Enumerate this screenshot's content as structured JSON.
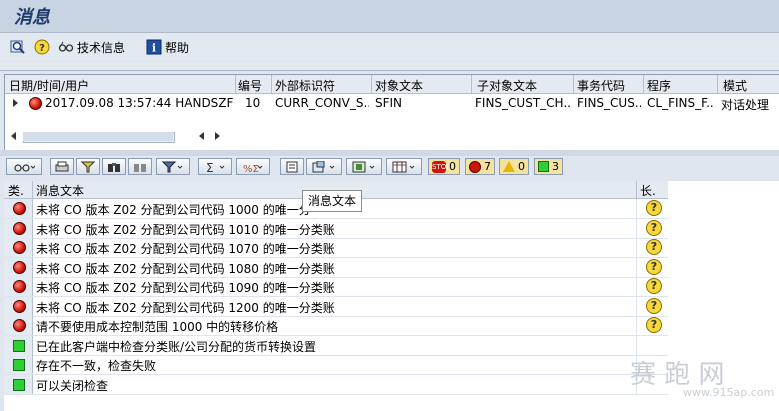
{
  "window": {
    "title": "消息"
  },
  "app_toolbar": {
    "items": [
      {
        "icon": "magnifier-icon",
        "label": ""
      },
      {
        "icon": "help-question-icon",
        "label": ""
      },
      {
        "icon": "glasses-icon",
        "label": "技术信息"
      },
      {
        "icon": "info-i-icon",
        "label": "帮助"
      }
    ]
  },
  "upper_table": {
    "headers": [
      "日期/时间/用户",
      "编号",
      "外部标识符",
      "对象文本",
      "子对象文本",
      "事务代码",
      "程序",
      "模式"
    ],
    "row": {
      "datetime": "2017.09.08  13:57:44  HANDSZF",
      "number": "10",
      "ext_id": "CURR_CONV_S...",
      "object_text": "SFIN",
      "subobject_text": "FINS_CUST_CH...",
      "tcode": "FINS_CUS...",
      "program": "CL_FINS_F...",
      "mode": "对话处理"
    }
  },
  "alv_toolbar": {
    "counters": {
      "stop": "0",
      "error": "7",
      "warning": "0",
      "success": "3"
    }
  },
  "grid": {
    "headers": {
      "type": "类.",
      "text": "消息文本",
      "long": "长."
    },
    "tooltip": "消息文本",
    "rows": [
      {
        "status": "error",
        "text": "未将 CO 版本 Z02 分配到公司代码 1000 的唯一分",
        "long": true
      },
      {
        "status": "error",
        "text": "未将 CO 版本 Z02 分配到公司代码 1010 的唯一分类账",
        "long": true
      },
      {
        "status": "error",
        "text": "未将 CO 版本 Z02 分配到公司代码 1070 的唯一分类账",
        "long": true
      },
      {
        "status": "error",
        "text": "未将 CO 版本 Z02 分配到公司代码 1080 的唯一分类账",
        "long": true
      },
      {
        "status": "error",
        "text": "未将 CO 版本 Z02 分配到公司代码 1090 的唯一分类账",
        "long": true
      },
      {
        "status": "error",
        "text": "未将 CO 版本 Z02 分配到公司代码 1200 的唯一分类账",
        "long": true
      },
      {
        "status": "error",
        "text": "请不要使用成本控制范围 1000 中的转移价格",
        "long": true
      },
      {
        "status": "success",
        "text": "已在此客户端中检查分类账/公司分配的货币转换设置",
        "long": false
      },
      {
        "status": "success",
        "text": "存在不一致，检查失败",
        "long": false
      },
      {
        "status": "success",
        "text": "可以关闭检查",
        "long": false
      }
    ]
  },
  "watermark": {
    "main": "赛 跑 网",
    "sub": "www.915ap.com"
  }
}
